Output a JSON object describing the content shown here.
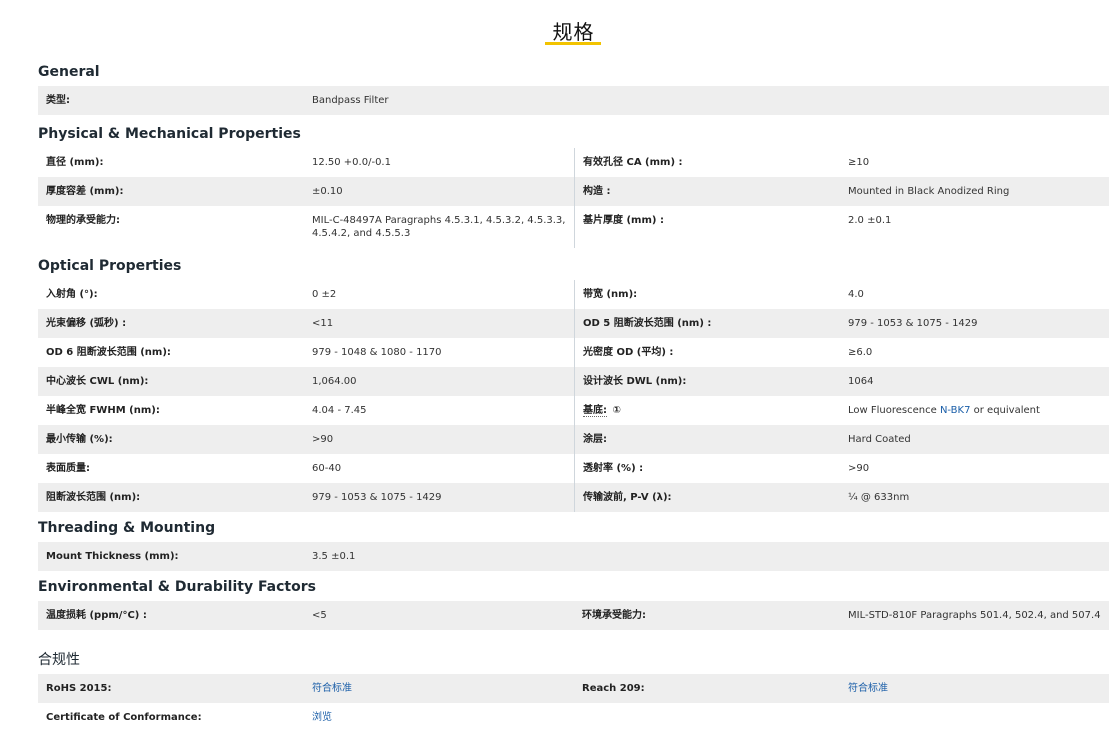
{
  "title": "规格",
  "sections": [
    {
      "name": "General",
      "rows": [
        {
          "l1": "类型:",
          "v1": "Bandpass Filter"
        }
      ]
    },
    {
      "name": "Physical & Mechanical Properties",
      "rows": [
        {
          "l1": "直径 (mm):",
          "v1": "12.50 +0.0/-0.1",
          "l2": "有效孔径 CA (mm) :",
          "v2": "≥10"
        },
        {
          "l1": "厚度容差 (mm):",
          "v1": "±0.10",
          "l2": "构造 :",
          "v2": "Mounted in Black Anodized Ring"
        },
        {
          "l1": "物理的承受能力:",
          "v1": "MIL-C-48497A Paragraphs 4.5.3.1, 4.5.3.2, 4.5.3.3, 4.5.4.2, and 4.5.5.3",
          "l2": "基片厚度 (mm) :",
          "v2": "2.0 ±0.1"
        }
      ]
    },
    {
      "name": "Optical Properties",
      "rows": [
        {
          "l1": "入射角 (°):",
          "v1": "0 ±2",
          "l2": "带宽 (nm):",
          "v2": "4.0"
        },
        {
          "l1": "光束偏移 (弧秒) :",
          "v1": "<11",
          "l2": "OD 5 阻断波长范围 (nm) :",
          "v2": "979 - 1053 & 1075 - 1429"
        },
        {
          "l1": "OD 6 阻断波长范围 (nm):",
          "v1": "979 - 1048 & 1080 - 1170",
          "l2": "光密度 OD (平均) :",
          "v2": "≥6.0"
        },
        {
          "l1": "中心波长 CWL (nm):",
          "v1": "1,064.00",
          "l2": "设计波长 DWL (nm):",
          "v2": "1064"
        },
        {
          "l1": "半峰全宽 FWHM (nm):",
          "v1": "4.04 - 7.45",
          "l2": "基底:",
          "l2_icon": "①",
          "v2_pre": "Low Fluorescence ",
          "v2_link": "N-BK7",
          "v2_post": " or equivalent"
        },
        {
          "l1": "最小传输 (%):",
          "v1": ">90",
          "l2": "涂层:",
          "v2": "Hard Coated"
        },
        {
          "l1": "表面质量:",
          "v1": "60-40",
          "l2": "透射率 (%) :",
          "v2": ">90"
        },
        {
          "l1": "阻断波长范围 (nm):",
          "v1": "979 - 1053 & 1075 - 1429",
          "l2": "传输波前, P-V (λ):",
          "v2": "¼ @ 633nm"
        }
      ]
    },
    {
      "name": "Threading & Mounting",
      "rows": [
        {
          "l1": "Mount Thickness (mm):",
          "v1": "3.5 ±0.1"
        }
      ]
    },
    {
      "name": "Environmental & Durability Factors",
      "rows": [
        {
          "l1": "温度损耗 (ppm/°C) :",
          "v1": "<5",
          "l2": "环境承受能力:",
          "v2": "MIL-STD-810F Paragraphs 501.4, 502.4, and 507.4"
        }
      ]
    }
  ],
  "compliance": {
    "name": "合规性",
    "rows": [
      {
        "l1": "RoHS 2015:",
        "v1": "符合标准",
        "l2": "Reach 209:",
        "v2": "符合标准"
      },
      {
        "l1": "Certificate of Conformance:",
        "v1": "浏览"
      }
    ]
  }
}
